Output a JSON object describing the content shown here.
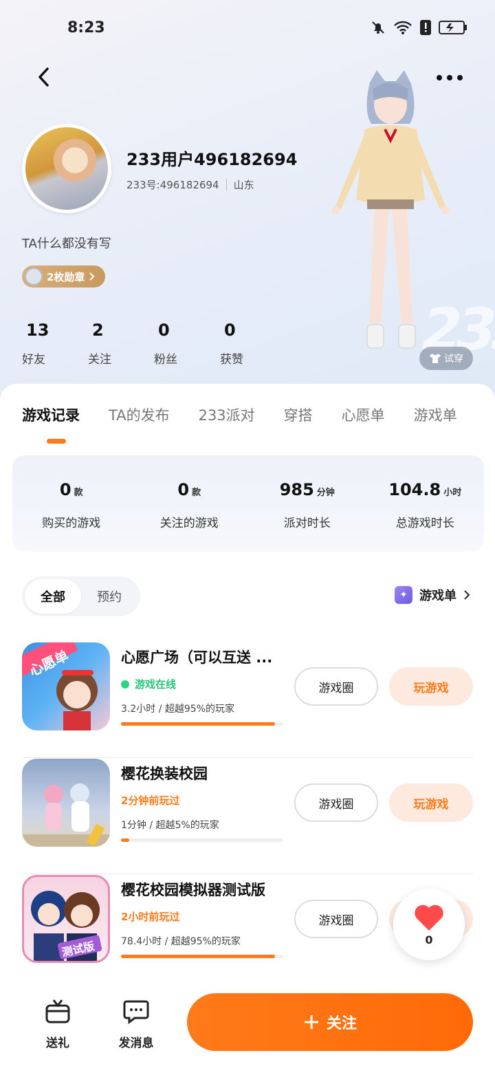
{
  "status_bar": {
    "time": "8:23"
  },
  "profile": {
    "username": "233用户496182694",
    "user_id": "233号:496182694",
    "location": "山东",
    "bio": "TA什么都没有写",
    "badge_label": "2枚勋章",
    "try_on_label": "试穿",
    "stats": [
      {
        "value": "13",
        "label": "好友"
      },
      {
        "value": "2",
        "label": "关注"
      },
      {
        "value": "0",
        "label": "粉丝"
      },
      {
        "value": "0",
        "label": "获赞"
      }
    ]
  },
  "tabs": [
    "游戏记录",
    "TA的发布",
    "233派对",
    "穿搭",
    "心愿单",
    "游戏单"
  ],
  "summary": [
    {
      "value": "0",
      "unit": "款",
      "label": "购买的游戏"
    },
    {
      "value": "0",
      "unit": "款",
      "label": "关注的游戏"
    },
    {
      "value": "985",
      "unit": "分钟",
      "label": "派对时长"
    },
    {
      "value": "104.8",
      "unit": "小时",
      "label": "总游戏时长"
    }
  ],
  "filters": {
    "all": "全部",
    "reserve": "预约"
  },
  "game_list_link": "游戏单",
  "games": [
    {
      "title": "心愿广场（可以互送 ...",
      "status": "游戏在线",
      "meta": "3.2小时  /  超越95%的玩家",
      "progress": 0.95,
      "circle_label": "游戏圈",
      "play_label": "玩游戏"
    },
    {
      "title": "樱花换装校园",
      "status": "2分钟前玩过",
      "meta": "1分钟  /  超越5%的玩家",
      "progress": 0.05,
      "circle_label": "游戏圈",
      "play_label": "玩游戏"
    },
    {
      "title": "樱花校园模拟器测试版",
      "status": "2小时前玩过",
      "meta": "78.4小时  /  超越95%的玩家",
      "progress": 0.95,
      "circle_label": "游戏圈",
      "play_label": "玩游戏"
    }
  ],
  "game_icon_text": {
    "wish": "心愿单",
    "test": "测试版"
  },
  "like_count": "0",
  "bottom_bar": {
    "gift": "送礼",
    "message": "发消息",
    "follow": "关注"
  },
  "colors": {
    "accent": "#ff7a1a",
    "online": "#2bc47a"
  }
}
